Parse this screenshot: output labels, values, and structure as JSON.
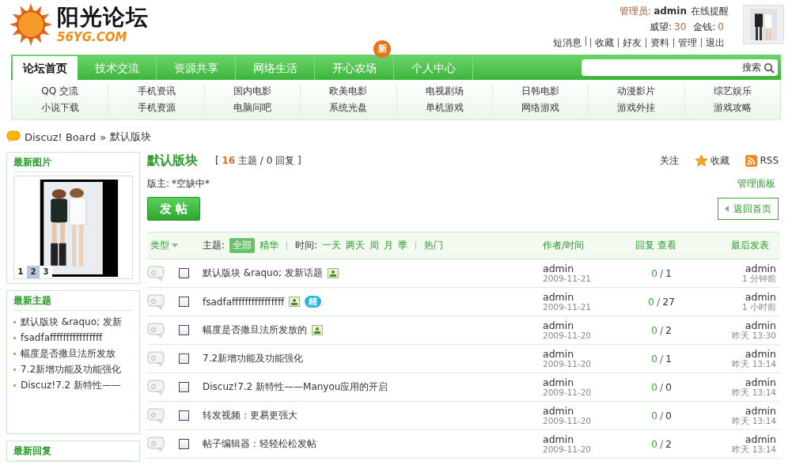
{
  "header": {
    "logo": {
      "title": "阳光论坛",
      "domain": "56YG.COM"
    },
    "user": {
      "role": "管理员:",
      "name": "admin",
      "notice": "在线提醒",
      "stats": [
        {
          "label": "威望:",
          "value": "30"
        },
        {
          "label": "金钱:",
          "value": "0"
        }
      ],
      "links": [
        {
          "kind": "link",
          "label": "短消息"
        },
        {
          "kind": "blank"
        },
        {
          "kind": "link",
          "label": "收藏"
        },
        {
          "kind": "link",
          "label": "好友"
        },
        {
          "kind": "link",
          "label": "资料"
        },
        {
          "kind": "link",
          "label": "管理"
        },
        {
          "kind": "link",
          "label": "退出"
        }
      ]
    }
  },
  "nav": {
    "tabs": [
      {
        "label": "论坛首页",
        "selected": true
      },
      {
        "label": "技术交流",
        "selected": false
      },
      {
        "label": "资源共享",
        "selected": false
      },
      {
        "label": "网络生活",
        "selected": false
      },
      {
        "label": "开心农场",
        "selected": false,
        "badge": "新"
      },
      {
        "label": "个人中心",
        "selected": false
      }
    ],
    "search": {
      "button": "搜索"
    }
  },
  "subnav": [
    "QQ 交流",
    "手机资讯",
    "国内电影",
    "欧美电影",
    "电视剧场",
    "日韩电影",
    "动漫影片",
    "综艺娱乐",
    "小说下载",
    "手机资源",
    "电脑问吧",
    "系统光盘",
    "单机游戏",
    "网络游戏",
    "游戏外挂",
    "游戏攻略"
  ],
  "breadcrumb": {
    "link": "Discuz! Board",
    "separator": "»",
    "current": "默认版块"
  },
  "sidebar": [
    {
      "kind": "pictures",
      "title": "最新图片",
      "pages": [
        {
          "label": "1",
          "selected": false
        },
        {
          "label": "2",
          "selected": true
        },
        {
          "label": "3",
          "selected": false
        }
      ]
    },
    {
      "kind": "list",
      "title": "最新主题",
      "items": [
        "默认版块 &raquo; 发新",
        "fsadfaffffffffffffffff",
        "幅度是否撒旦法所发放",
        "7.2新增功能及功能强化",
        "Discuz!7.2 新特性——"
      ]
    },
    {
      "kind": "list",
      "title": "最新回复"
    }
  ],
  "forum": {
    "title": "默认版块",
    "stats": "[ **16** 主题 / 0 回复 ]",
    "actions": [
      {
        "kind": "follow",
        "label": "关注"
      },
      {
        "kind": "favorite",
        "label": "收藏"
      },
      {
        "kind": "rss",
        "label": "RSS"
      }
    ],
    "moderator_label": "版主:",
    "moderator": "*空缺中*",
    "manage": "管理面板",
    "post_button": "发 帖",
    "back_button": "返回首页"
  },
  "table": {
    "type": "类型",
    "topic_label": "主题:",
    "topic_filters": [
      {
        "label": "全部",
        "selected": true
      },
      {
        "label": "精华",
        "selected": false
      }
    ],
    "time_label": "时间:",
    "time_filters": [
      "一天",
      "两天",
      "周",
      "月",
      "季"
    ],
    "hot": "热门",
    "author": "作者/时间",
    "stats": "回复 查看",
    "last": "最后发表",
    "count_separator": "/",
    "rows": [
      {
        "title": "默认版块 &raquo; 发新话题",
        "attachment": true,
        "checked": false,
        "author": "admin",
        "date": "2009-11-21",
        "replies": "0",
        "views": "1",
        "last_author": "admin",
        "last_time": "1 分钟前"
      },
      {
        "title": "fsadfaffffffffffffffff",
        "attachment": true,
        "digest": "精",
        "checked": false,
        "author": "admin",
        "date": "2009-11-21",
        "replies": "0",
        "views": "27",
        "last_author": "admin",
        "last_time": "1 小时前"
      },
      {
        "title": "幅度是否撒旦法所发放的",
        "attachment": true,
        "checked": false,
        "author": "admin",
        "date": "2009-11-20",
        "replies": "0",
        "views": "2",
        "last_author": "admin",
        "last_time": "昨天 13:30"
      },
      {
        "title": "7.2新增功能及功能强化",
        "attachment": false,
        "checked": false,
        "author": "admin",
        "date": "2009-11-20",
        "replies": "0",
        "views": "1",
        "last_author": "admin",
        "last_time": "昨天 13:14"
      },
      {
        "title": "Discuz!7.2 新特性——Manyou应用的开启",
        "attachment": false,
        "checked": false,
        "author": "admin",
        "date": "2009-11-20",
        "replies": "0",
        "views": "0",
        "last_author": "admin",
        "last_time": "昨天 13:14"
      },
      {
        "title": "转发视频：更易更强大",
        "attachment": false,
        "checked": false,
        "author": "admin",
        "date": "2009-11-20",
        "replies": "0",
        "views": "0",
        "last_author": "admin",
        "last_time": "昨天 13:14"
      },
      {
        "title": "帖子编辑器：轻轻松松发帖",
        "attachment": false,
        "checked": false,
        "author": "admin",
        "date": "2009-11-20",
        "replies": "0",
        "views": "2",
        "last_author": "admin",
        "last_time": "昨天 13:14"
      }
    ]
  }
}
